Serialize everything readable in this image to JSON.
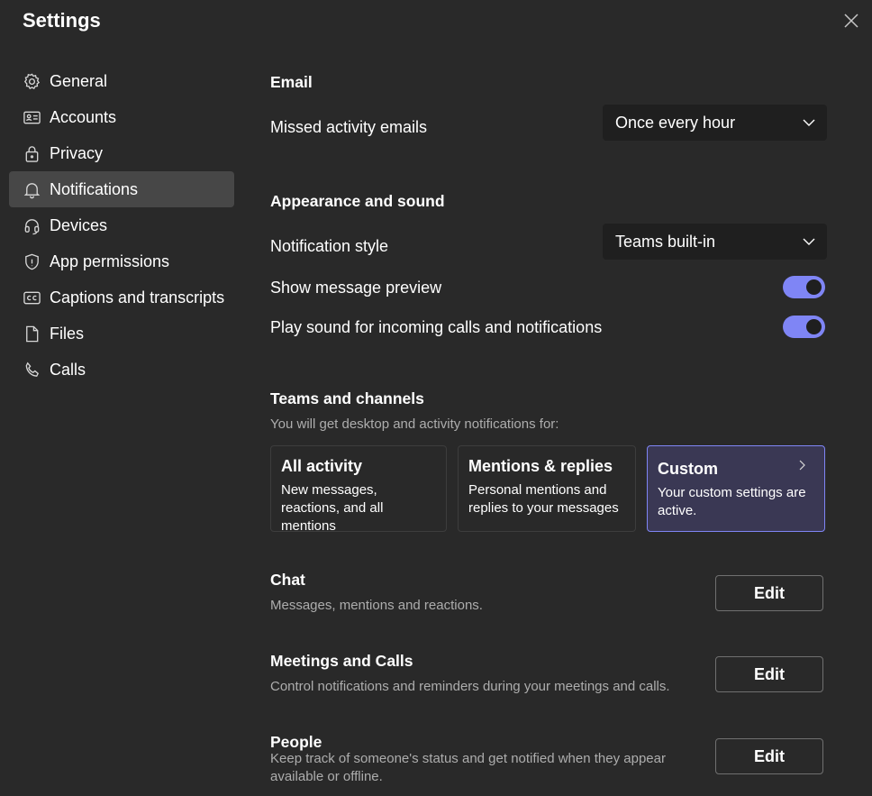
{
  "window": {
    "title": "Settings",
    "close_icon": "close-icon"
  },
  "sidebar": {
    "items": [
      {
        "label": "General",
        "icon": "gear-icon"
      },
      {
        "label": "Accounts",
        "icon": "id-card-icon"
      },
      {
        "label": "Privacy",
        "icon": "lock-icon"
      },
      {
        "label": "Notifications",
        "icon": "bell-icon",
        "active": true
      },
      {
        "label": "Devices",
        "icon": "headset-icon"
      },
      {
        "label": "App permissions",
        "icon": "shield-icon"
      },
      {
        "label": "Captions and transcripts",
        "icon": "cc-icon"
      },
      {
        "label": "Files",
        "icon": "file-icon"
      },
      {
        "label": "Calls",
        "icon": "phone-icon"
      }
    ]
  },
  "email": {
    "heading": "Email",
    "missed_label": "Missed activity emails",
    "missed_value": "Once every hour"
  },
  "appearance": {
    "heading": "Appearance and sound",
    "style_label": "Notification style",
    "style_value": "Teams built-in",
    "preview_label": "Show message preview",
    "preview_on": true,
    "sound_label": "Play sound for incoming calls and notifications",
    "sound_on": true
  },
  "teams": {
    "heading": "Teams and channels",
    "subtitle": "You will get desktop and activity notifications for:",
    "cards": [
      {
        "title": "All activity",
        "desc": "New messages, reactions, and all mentions"
      },
      {
        "title": "Mentions & replies",
        "desc": "Personal mentions and replies to your messages"
      },
      {
        "title": "Custom",
        "desc": "Your custom settings are active.",
        "selected": true
      }
    ]
  },
  "chat": {
    "heading": "Chat",
    "desc": "Messages, mentions and reactions.",
    "button": "Edit"
  },
  "meetings": {
    "heading": "Meetings and Calls",
    "desc": "Control notifications and reminders during your meetings and calls.",
    "button": "Edit"
  },
  "people": {
    "heading": "People",
    "desc": "Keep track of someone's status and get notified when they appear available or offline.",
    "button": "Edit"
  },
  "colors": {
    "background": "#292929",
    "accent": "#7f85f5",
    "active_nav": "#474747",
    "dropdown": "#1f1f1f",
    "selected_card": "#3a3854"
  }
}
